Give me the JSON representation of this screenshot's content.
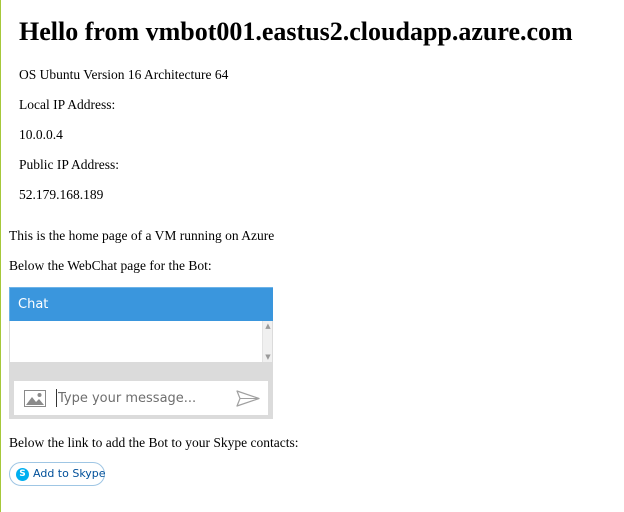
{
  "page": {
    "title": "Hello from vmbot001.eastus2.cloudapp.azure.com",
    "os_line": "OS Ubuntu Version 16 Architecture 64",
    "local_ip_label": "Local IP Address:",
    "local_ip_value": "10.0.0.4",
    "public_ip_label": "Public IP Address:",
    "public_ip_value": "52.179.168.189",
    "home_text": "This is the home page of a VM running on Azure",
    "webchat_intro": "Below the WebChat page for the Bot:",
    "skype_intro": "Below the link to add the Bot to your Skype contacts:"
  },
  "chat": {
    "header_label": "Chat",
    "input_placeholder": "Type your message...",
    "icons": {
      "attach": "image-icon",
      "send": "send-icon",
      "scroll_up": "chevron-up-icon",
      "scroll_down": "chevron-down-icon"
    },
    "colors": {
      "header_bg": "#3a96dd",
      "header_text": "#ffffff",
      "frame": "#dbdbdb"
    }
  },
  "skype": {
    "button_label": "Add to Skype",
    "icon": "skype-icon",
    "icon_letter": "S",
    "colors": {
      "icon_bg": "#00aff0",
      "border": "#9fc6e4",
      "text": "#00509a"
    }
  }
}
